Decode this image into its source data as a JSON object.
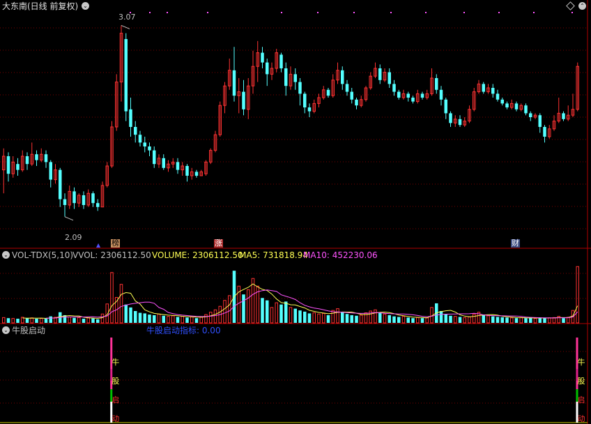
{
  "main_panel": {
    "title": "大东南(日线 前复权)",
    "high_label": "3.07",
    "low_label": "2.09",
    "markers": [
      "榜",
      "涨",
      "财"
    ],
    "arrow_glyph": "▲",
    "colors": {
      "up": "#ff3232",
      "down": "#54ffff",
      "grid": "#7a0000",
      "text": "#c0c0c0"
    }
  },
  "volume_panel": {
    "name": "VOL-TDX(5,10)",
    "vvol_label": "VVOL: 2306112.50",
    "volume_label": "VOLUME: 2306112.50",
    "ma5_label": "MA5: 731818.94",
    "ma10_label": "MA10: 452230.06",
    "colors": {
      "volume": "#ffff54",
      "ma5": "#ffff54",
      "ma10": "#ff54ff"
    }
  },
  "indicator_panel": {
    "name": "牛股启动",
    "value_label": "牛股启动指标: 0.00",
    "signal_chars": [
      "牛",
      "股",
      "启",
      "动"
    ],
    "colors": {
      "value": "#3050ff"
    }
  },
  "chart_data": {
    "type": "candlestick",
    "title": "大东南(日线 前复权)",
    "price_ylim": [
      2.0,
      3.15
    ],
    "high": 3.07,
    "low": 2.09,
    "candles": [
      {
        "o": 2.33,
        "c": 2.4,
        "h": 2.44,
        "l": 2.21
      },
      {
        "o": 2.4,
        "c": 2.31,
        "h": 2.42,
        "l": 2.27
      },
      {
        "o": 2.31,
        "c": 2.37,
        "h": 2.4,
        "l": 2.29
      },
      {
        "o": 2.36,
        "c": 2.33,
        "h": 2.39,
        "l": 2.3
      },
      {
        "o": 2.33,
        "c": 2.4,
        "h": 2.43,
        "l": 2.32
      },
      {
        "o": 2.4,
        "c": 2.36,
        "h": 2.42,
        "l": 2.33
      },
      {
        "o": 2.36,
        "c": 2.41,
        "h": 2.47,
        "l": 2.35
      },
      {
        "o": 2.41,
        "c": 2.38,
        "h": 2.43,
        "l": 2.35
      },
      {
        "o": 2.38,
        "c": 2.41,
        "h": 2.44,
        "l": 2.37
      },
      {
        "o": 2.41,
        "c": 2.37,
        "h": 2.43,
        "l": 2.34
      },
      {
        "o": 2.37,
        "c": 2.28,
        "h": 2.38,
        "l": 2.24
      },
      {
        "o": 2.28,
        "c": 2.33,
        "h": 2.36,
        "l": 2.26
      },
      {
        "o": 2.33,
        "c": 2.18,
        "h": 2.34,
        "l": 2.14
      },
      {
        "o": 2.18,
        "c": 2.15,
        "h": 2.21,
        "l": 2.09
      },
      {
        "o": 2.15,
        "c": 2.22,
        "h": 2.25,
        "l": 2.13
      },
      {
        "o": 2.22,
        "c": 2.16,
        "h": 2.24,
        "l": 2.13
      },
      {
        "o": 2.16,
        "c": 2.2,
        "h": 2.21,
        "l": 2.14
      },
      {
        "o": 2.2,
        "c": 2.15,
        "h": 2.22,
        "l": 2.13
      },
      {
        "o": 2.15,
        "c": 2.21,
        "h": 2.23,
        "l": 2.14
      },
      {
        "o": 2.21,
        "c": 2.16,
        "h": 2.22,
        "l": 2.14
      },
      {
        "o": 2.16,
        "c": 2.14,
        "h": 2.18,
        "l": 2.12
      },
      {
        "o": 2.14,
        "c": 2.25,
        "h": 2.27,
        "l": 2.14
      },
      {
        "o": 2.25,
        "c": 2.35,
        "h": 2.37,
        "l": 2.24
      },
      {
        "o": 2.35,
        "c": 2.55,
        "h": 2.58,
        "l": 2.34
      },
      {
        "o": 2.55,
        "c": 2.78,
        "h": 2.82,
        "l": 2.53
      },
      {
        "o": 2.78,
        "c": 3.03,
        "h": 3.07,
        "l": 2.68
      },
      {
        "o": 3.0,
        "c": 2.63,
        "h": 3.03,
        "l": 2.58
      },
      {
        "o": 2.64,
        "c": 2.55,
        "h": 2.7,
        "l": 2.5
      },
      {
        "o": 2.55,
        "c": 2.51,
        "h": 2.58,
        "l": 2.47
      },
      {
        "o": 2.51,
        "c": 2.47,
        "h": 2.53,
        "l": 2.45
      },
      {
        "o": 2.47,
        "c": 2.45,
        "h": 2.5,
        "l": 2.42
      },
      {
        "o": 2.45,
        "c": 2.43,
        "h": 2.47,
        "l": 2.4
      },
      {
        "o": 2.43,
        "c": 2.36,
        "h": 2.45,
        "l": 2.34
      },
      {
        "o": 2.36,
        "c": 2.39,
        "h": 2.41,
        "l": 2.34
      },
      {
        "o": 2.39,
        "c": 2.34,
        "h": 2.41,
        "l": 2.33
      },
      {
        "o": 2.34,
        "c": 2.36,
        "h": 2.38,
        "l": 2.32
      },
      {
        "o": 2.36,
        "c": 2.37,
        "h": 2.39,
        "l": 2.34
      },
      {
        "o": 2.37,
        "c": 2.33,
        "h": 2.39,
        "l": 2.31
      },
      {
        "o": 2.33,
        "c": 2.35,
        "h": 2.37,
        "l": 2.3
      },
      {
        "o": 2.35,
        "c": 2.3,
        "h": 2.36,
        "l": 2.27
      },
      {
        "o": 2.3,
        "c": 2.32,
        "h": 2.34,
        "l": 2.28
      },
      {
        "o": 2.32,
        "c": 2.3,
        "h": 2.33,
        "l": 2.29
      },
      {
        "o": 2.3,
        "c": 2.32,
        "h": 2.33,
        "l": 2.3
      },
      {
        "o": 2.31,
        "c": 2.37,
        "h": 2.38,
        "l": 2.3
      },
      {
        "o": 2.37,
        "c": 2.43,
        "h": 2.44,
        "l": 2.36
      },
      {
        "o": 2.43,
        "c": 2.51,
        "h": 2.53,
        "l": 2.42
      },
      {
        "o": 2.51,
        "c": 2.66,
        "h": 2.68,
        "l": 2.5
      },
      {
        "o": 2.66,
        "c": 2.76,
        "h": 2.78,
        "l": 2.62
      },
      {
        "o": 2.76,
        "c": 2.84,
        "h": 2.9,
        "l": 2.74
      },
      {
        "o": 2.84,
        "c": 2.71,
        "h": 2.96,
        "l": 2.68
      },
      {
        "o": 2.71,
        "c": 2.73,
        "h": 2.8,
        "l": 2.62
      },
      {
        "o": 2.73,
        "c": 2.64,
        "h": 2.79,
        "l": 2.61
      },
      {
        "o": 2.64,
        "c": 2.76,
        "h": 2.8,
        "l": 2.59
      },
      {
        "o": 2.76,
        "c": 2.86,
        "h": 2.94,
        "l": 2.72
      },
      {
        "o": 2.86,
        "c": 2.93,
        "h": 2.99,
        "l": 2.78
      },
      {
        "o": 2.93,
        "c": 2.88,
        "h": 2.96,
        "l": 2.85
      },
      {
        "o": 2.88,
        "c": 2.82,
        "h": 2.9,
        "l": 2.76
      },
      {
        "o": 2.82,
        "c": 2.85,
        "h": 2.88,
        "l": 2.79
      },
      {
        "o": 2.85,
        "c": 2.93,
        "h": 2.95,
        "l": 2.83
      },
      {
        "o": 2.92,
        "c": 2.85,
        "h": 2.93,
        "l": 2.83
      },
      {
        "o": 2.85,
        "c": 2.76,
        "h": 2.88,
        "l": 2.71
      },
      {
        "o": 2.76,
        "c": 2.82,
        "h": 2.86,
        "l": 2.74
      },
      {
        "o": 2.82,
        "c": 2.78,
        "h": 2.85,
        "l": 2.74
      },
      {
        "o": 2.78,
        "c": 2.72,
        "h": 2.8,
        "l": 2.66
      },
      {
        "o": 2.72,
        "c": 2.65,
        "h": 2.73,
        "l": 2.62
      },
      {
        "o": 2.65,
        "c": 2.63,
        "h": 2.67,
        "l": 2.6
      },
      {
        "o": 2.63,
        "c": 2.67,
        "h": 2.69,
        "l": 2.62
      },
      {
        "o": 2.67,
        "c": 2.7,
        "h": 2.72,
        "l": 2.65
      },
      {
        "o": 2.7,
        "c": 2.74,
        "h": 2.76,
        "l": 2.69
      },
      {
        "o": 2.74,
        "c": 2.71,
        "h": 2.75,
        "l": 2.7
      },
      {
        "o": 2.71,
        "c": 2.79,
        "h": 2.82,
        "l": 2.7
      },
      {
        "o": 2.79,
        "c": 2.84,
        "h": 2.88,
        "l": 2.77
      },
      {
        "o": 2.84,
        "c": 2.77,
        "h": 2.86,
        "l": 2.74
      },
      {
        "o": 2.77,
        "c": 2.73,
        "h": 2.79,
        "l": 2.71
      },
      {
        "o": 2.73,
        "c": 2.69,
        "h": 2.75,
        "l": 2.67
      },
      {
        "o": 2.69,
        "c": 2.66,
        "h": 2.7,
        "l": 2.64
      },
      {
        "o": 2.66,
        "c": 2.69,
        "h": 2.71,
        "l": 2.65
      },
      {
        "o": 2.69,
        "c": 2.75,
        "h": 2.76,
        "l": 2.68
      },
      {
        "o": 2.75,
        "c": 2.81,
        "h": 2.83,
        "l": 2.74
      },
      {
        "o": 2.81,
        "c": 2.85,
        "h": 2.88,
        "l": 2.8
      },
      {
        "o": 2.85,
        "c": 2.79,
        "h": 2.87,
        "l": 2.77
      },
      {
        "o": 2.79,
        "c": 2.83,
        "h": 2.85,
        "l": 2.78
      },
      {
        "o": 2.83,
        "c": 2.77,
        "h": 2.85,
        "l": 2.75
      },
      {
        "o": 2.77,
        "c": 2.73,
        "h": 2.79,
        "l": 2.71
      },
      {
        "o": 2.73,
        "c": 2.7,
        "h": 2.74,
        "l": 2.69
      },
      {
        "o": 2.7,
        "c": 2.72,
        "h": 2.74,
        "l": 2.69
      },
      {
        "o": 2.72,
        "c": 2.7,
        "h": 2.73,
        "l": 2.68
      },
      {
        "o": 2.7,
        "c": 2.68,
        "h": 2.71,
        "l": 2.67
      },
      {
        "o": 2.68,
        "c": 2.72,
        "h": 2.74,
        "l": 2.67
      },
      {
        "o": 2.72,
        "c": 2.7,
        "h": 2.73,
        "l": 2.69
      },
      {
        "o": 2.7,
        "c": 2.72,
        "h": 2.74,
        "l": 2.69
      },
      {
        "o": 2.72,
        "c": 2.8,
        "h": 2.85,
        "l": 2.71
      },
      {
        "o": 2.8,
        "c": 2.74,
        "h": 2.82,
        "l": 2.72
      },
      {
        "o": 2.74,
        "c": 2.69,
        "h": 2.76,
        "l": 2.66
      },
      {
        "o": 2.69,
        "c": 2.62,
        "h": 2.7,
        "l": 2.59
      },
      {
        "o": 2.62,
        "c": 2.57,
        "h": 2.63,
        "l": 2.55
      },
      {
        "o": 2.57,
        "c": 2.59,
        "h": 2.61,
        "l": 2.55
      },
      {
        "o": 2.59,
        "c": 2.56,
        "h": 2.61,
        "l": 2.55
      },
      {
        "o": 2.56,
        "c": 2.58,
        "h": 2.6,
        "l": 2.55
      },
      {
        "o": 2.58,
        "c": 2.64,
        "h": 2.66,
        "l": 2.57
      },
      {
        "o": 2.64,
        "c": 2.73,
        "h": 2.75,
        "l": 2.63
      },
      {
        "o": 2.73,
        "c": 2.77,
        "h": 2.79,
        "l": 2.72
      },
      {
        "o": 2.77,
        "c": 2.73,
        "h": 2.78,
        "l": 2.72
      },
      {
        "o": 2.73,
        "c": 2.75,
        "h": 2.77,
        "l": 2.72
      },
      {
        "o": 2.75,
        "c": 2.72,
        "h": 2.77,
        "l": 2.7
      },
      {
        "o": 2.72,
        "c": 2.69,
        "h": 2.74,
        "l": 2.68
      },
      {
        "o": 2.69,
        "c": 2.67,
        "h": 2.7,
        "l": 2.66
      },
      {
        "o": 2.67,
        "c": 2.65,
        "h": 2.68,
        "l": 2.64
      },
      {
        "o": 2.65,
        "c": 2.67,
        "h": 2.69,
        "l": 2.64
      },
      {
        "o": 2.67,
        "c": 2.64,
        "h": 2.68,
        "l": 2.63
      },
      {
        "o": 2.64,
        "c": 2.66,
        "h": 2.67,
        "l": 2.63
      },
      {
        "o": 2.66,
        "c": 2.62,
        "h": 2.67,
        "l": 2.61
      },
      {
        "o": 2.62,
        "c": 2.6,
        "h": 2.63,
        "l": 2.58
      },
      {
        "o": 2.6,
        "c": 2.61,
        "h": 2.62,
        "l": 2.59
      },
      {
        "o": 2.61,
        "c": 2.55,
        "h": 2.62,
        "l": 2.52
      },
      {
        "o": 2.55,
        "c": 2.5,
        "h": 2.56,
        "l": 2.47
      },
      {
        "o": 2.5,
        "c": 2.54,
        "h": 2.56,
        "l": 2.49
      },
      {
        "o": 2.54,
        "c": 2.58,
        "h": 2.61,
        "l": 2.53
      },
      {
        "o": 2.58,
        "c": 2.62,
        "h": 2.7,
        "l": 2.57
      },
      {
        "o": 2.62,
        "c": 2.59,
        "h": 2.63,
        "l": 2.58
      },
      {
        "o": 2.59,
        "c": 2.61,
        "h": 2.66,
        "l": 2.58
      },
      {
        "o": 2.61,
        "c": 2.64,
        "h": 2.72,
        "l": 2.6
      },
      {
        "o": 2.64,
        "c": 2.86,
        "h": 2.88,
        "l": 2.63
      }
    ],
    "volume_ylim": [
      0,
      1000
    ],
    "volumes": [
      90,
      80,
      75,
      70,
      95,
      80,
      85,
      70,
      75,
      70,
      110,
      95,
      180,
      130,
      100,
      85,
      90,
      70,
      85,
      75,
      60,
      150,
      320,
      850,
      430,
      650,
      310,
      260,
      200,
      170,
      160,
      140,
      130,
      150,
      120,
      110,
      120,
      100,
      110,
      90,
      100,
      80,
      95,
      140,
      180,
      220,
      280,
      380,
      460,
      880,
      620,
      480,
      560,
      750,
      620,
      420,
      380,
      260,
      340,
      310,
      360,
      260,
      240,
      210,
      190,
      160,
      170,
      150,
      160,
      130,
      210,
      240,
      180,
      150,
      130,
      120,
      130,
      170,
      200,
      220,
      170,
      150,
      130,
      110,
      100,
      110,
      90,
      80,
      90,
      80,
      85,
      260,
      330,
      200,
      150,
      120,
      110,
      100,
      90,
      100,
      150,
      180,
      140,
      120,
      110,
      100,
      95,
      90,
      85,
      80,
      90,
      80,
      85,
      75,
      90,
      80,
      85,
      90,
      110,
      80,
      95,
      210,
      950
    ],
    "indicator_signal_bars": [
      23,
      122
    ],
    "indicator_value": 0.0
  }
}
